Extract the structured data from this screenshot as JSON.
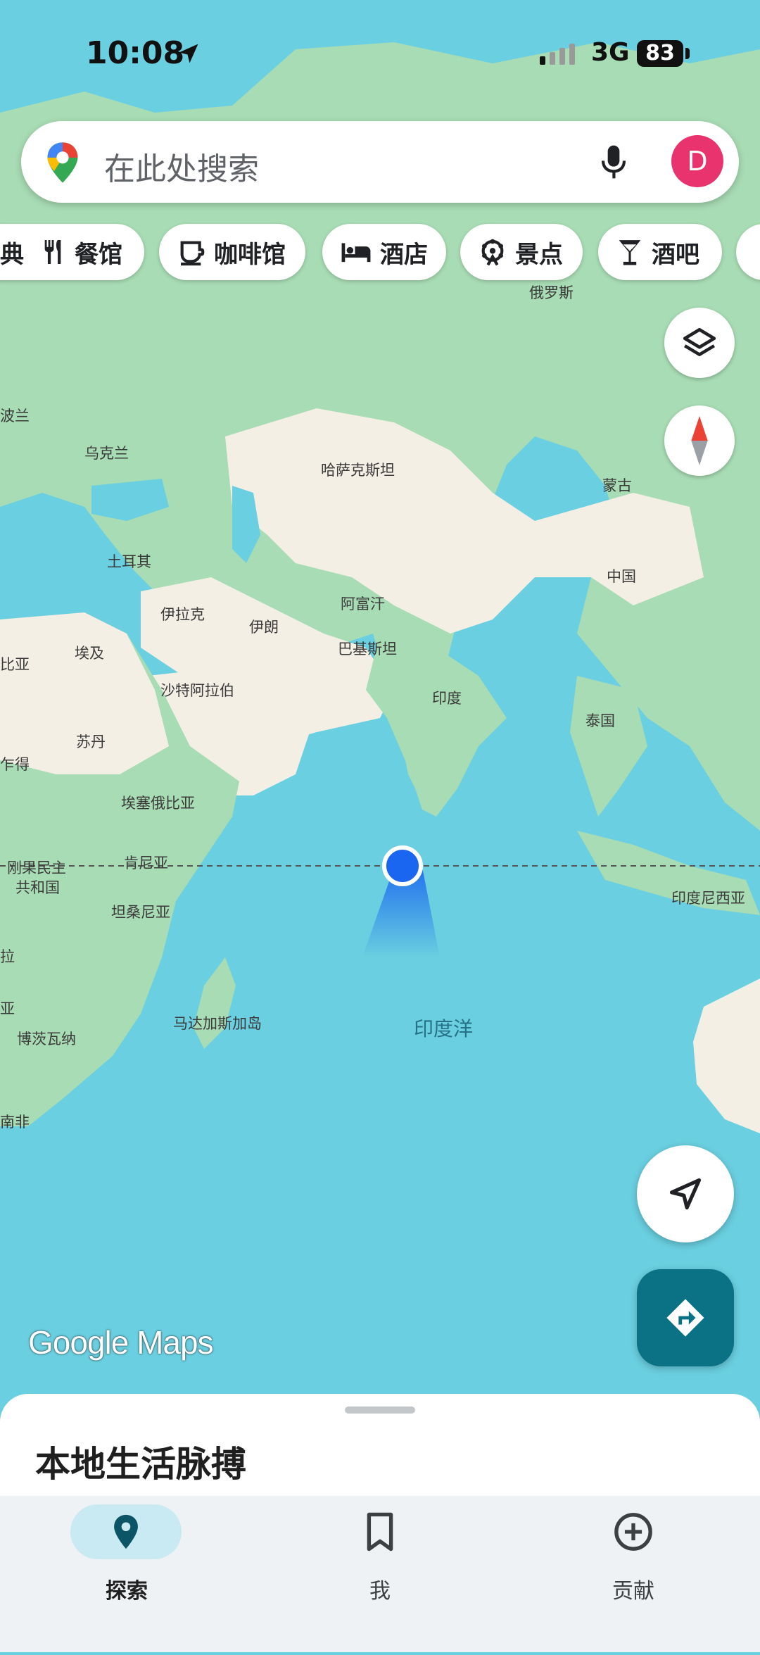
{
  "status_bar": {
    "time": "10:08",
    "network": "3G",
    "battery": "83"
  },
  "search": {
    "placeholder": "在此处搜索",
    "avatar_letter": "D"
  },
  "chips": [
    {
      "label": "典",
      "icon": "partial-chip"
    },
    {
      "label": "餐馆",
      "icon": "restaurant-icon"
    },
    {
      "label": "咖啡馆",
      "icon": "coffee-icon"
    },
    {
      "label": "酒店",
      "icon": "hotel-icon"
    },
    {
      "label": "景点",
      "icon": "attraction-icon"
    },
    {
      "label": "酒吧",
      "icon": "bar-icon"
    }
  ],
  "map": {
    "labels": {
      "russia": "俄罗斯",
      "poland": "波兰",
      "ukraine": "乌克兰",
      "kazakhstan": "哈萨克斯坦",
      "mongolia": "蒙古",
      "turkey": "土耳其",
      "china": "中国",
      "iraq": "伊拉克",
      "iran": "伊朗",
      "afghanistan": "阿富汗",
      "pakistan": "巴基斯坦",
      "libya_partial": "比亚",
      "egypt": "埃及",
      "saudi": "沙特阿拉伯",
      "india": "印度",
      "thailand": "泰国",
      "sudan": "苏丹",
      "chad_partial": "乍得",
      "ethiopia": "埃塞俄比亚",
      "drc_line1": "刚果民主",
      "drc_line2": "共和国",
      "kenya": "肯尼亚",
      "indonesia": "印度尼西亚",
      "tanzania": "坦桑尼亚",
      "angola_partial": "拉",
      "zambia_partial": "亚",
      "madagascar": "马达加斯加岛",
      "botswana": "博茨瓦纳",
      "south_africa": "南非",
      "indian_ocean": "印度洋"
    },
    "colors": {
      "water": "#6acfe0",
      "land_green": "#a8dcb4",
      "land_desert": "#f4efe4",
      "accent": "#0b7285",
      "user_dot": "#1a66f0"
    }
  },
  "logo": "Google Maps",
  "sheet": {
    "title": "本地生活脉搏"
  },
  "bottom_nav": [
    {
      "label": "探索",
      "icon": "explore-pin-icon",
      "active": true
    },
    {
      "label": "我",
      "icon": "bookmark-icon",
      "active": false
    },
    {
      "label": "贡献",
      "icon": "add-circle-icon",
      "active": false
    }
  ]
}
